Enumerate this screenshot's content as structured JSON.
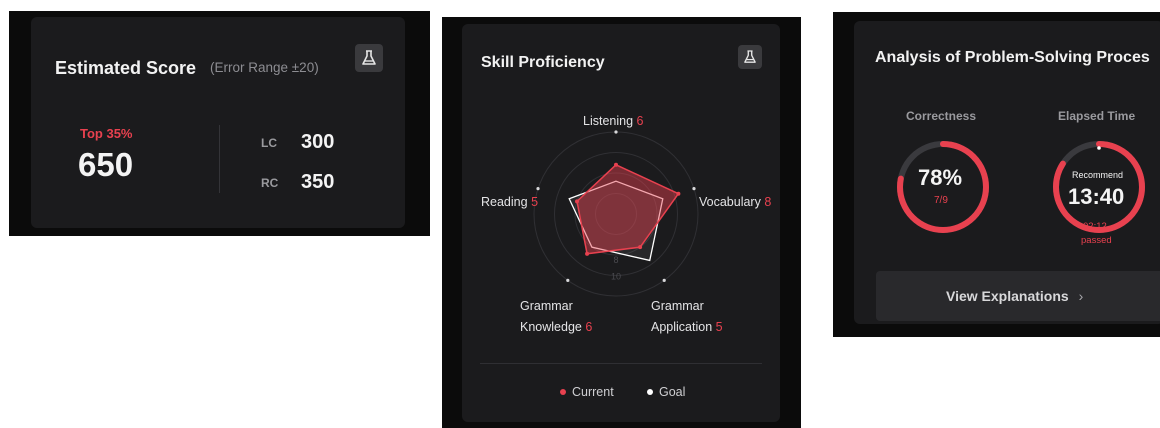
{
  "score_card": {
    "title": "Estimated Score",
    "subtitle": "(Error Range ±20)",
    "icon": "flask-icon",
    "rank_label": "Top 35%",
    "score": "650",
    "lc_label": "LC",
    "lc_value": "300",
    "rc_label": "RC",
    "rc_value": "350"
  },
  "skill_card": {
    "title": "Skill Proficiency",
    "icon": "flask-icon",
    "skills": [
      {
        "name": "Listening",
        "name_line2": "",
        "current": 6
      },
      {
        "name": "Vocabulary",
        "name_line2": "",
        "current": 8
      },
      {
        "name": "Grammar",
        "name_line2": "Application",
        "current": 5
      },
      {
        "name": "Grammar",
        "name_line2": "Knowledge",
        "current": 6
      },
      {
        "name": "Reading",
        "name_line2": "",
        "current": 5
      }
    ],
    "values": {
      "listening": "6",
      "vocabulary": "8",
      "grammar_application": "5",
      "grammar_knowledge": "6",
      "reading": "5"
    },
    "goal_values": [
      4,
      6,
      7,
      5,
      6
    ],
    "scale_labels": [
      "8",
      "10"
    ],
    "scale_max": 10,
    "legend_current": "Current",
    "legend_goal": "Goal",
    "colors": {
      "current": "#e8414f",
      "goal": "#ffffff"
    }
  },
  "analysis_card": {
    "title": "Analysis of Problem-Solving Proces",
    "correctness_label": "Correctness",
    "correctness_percent": "78%",
    "correctness_fraction": "7/9",
    "correctness_level": 0.78,
    "elapsed_label": "Elapsed Time",
    "recommend_label": "Recommend",
    "recommend_time": "13:40",
    "passed_time": "02:12",
    "passed_label": "passed",
    "elapsed_level": 0.84,
    "view_button": "View Explanations",
    "accent": "#e8414f"
  }
}
